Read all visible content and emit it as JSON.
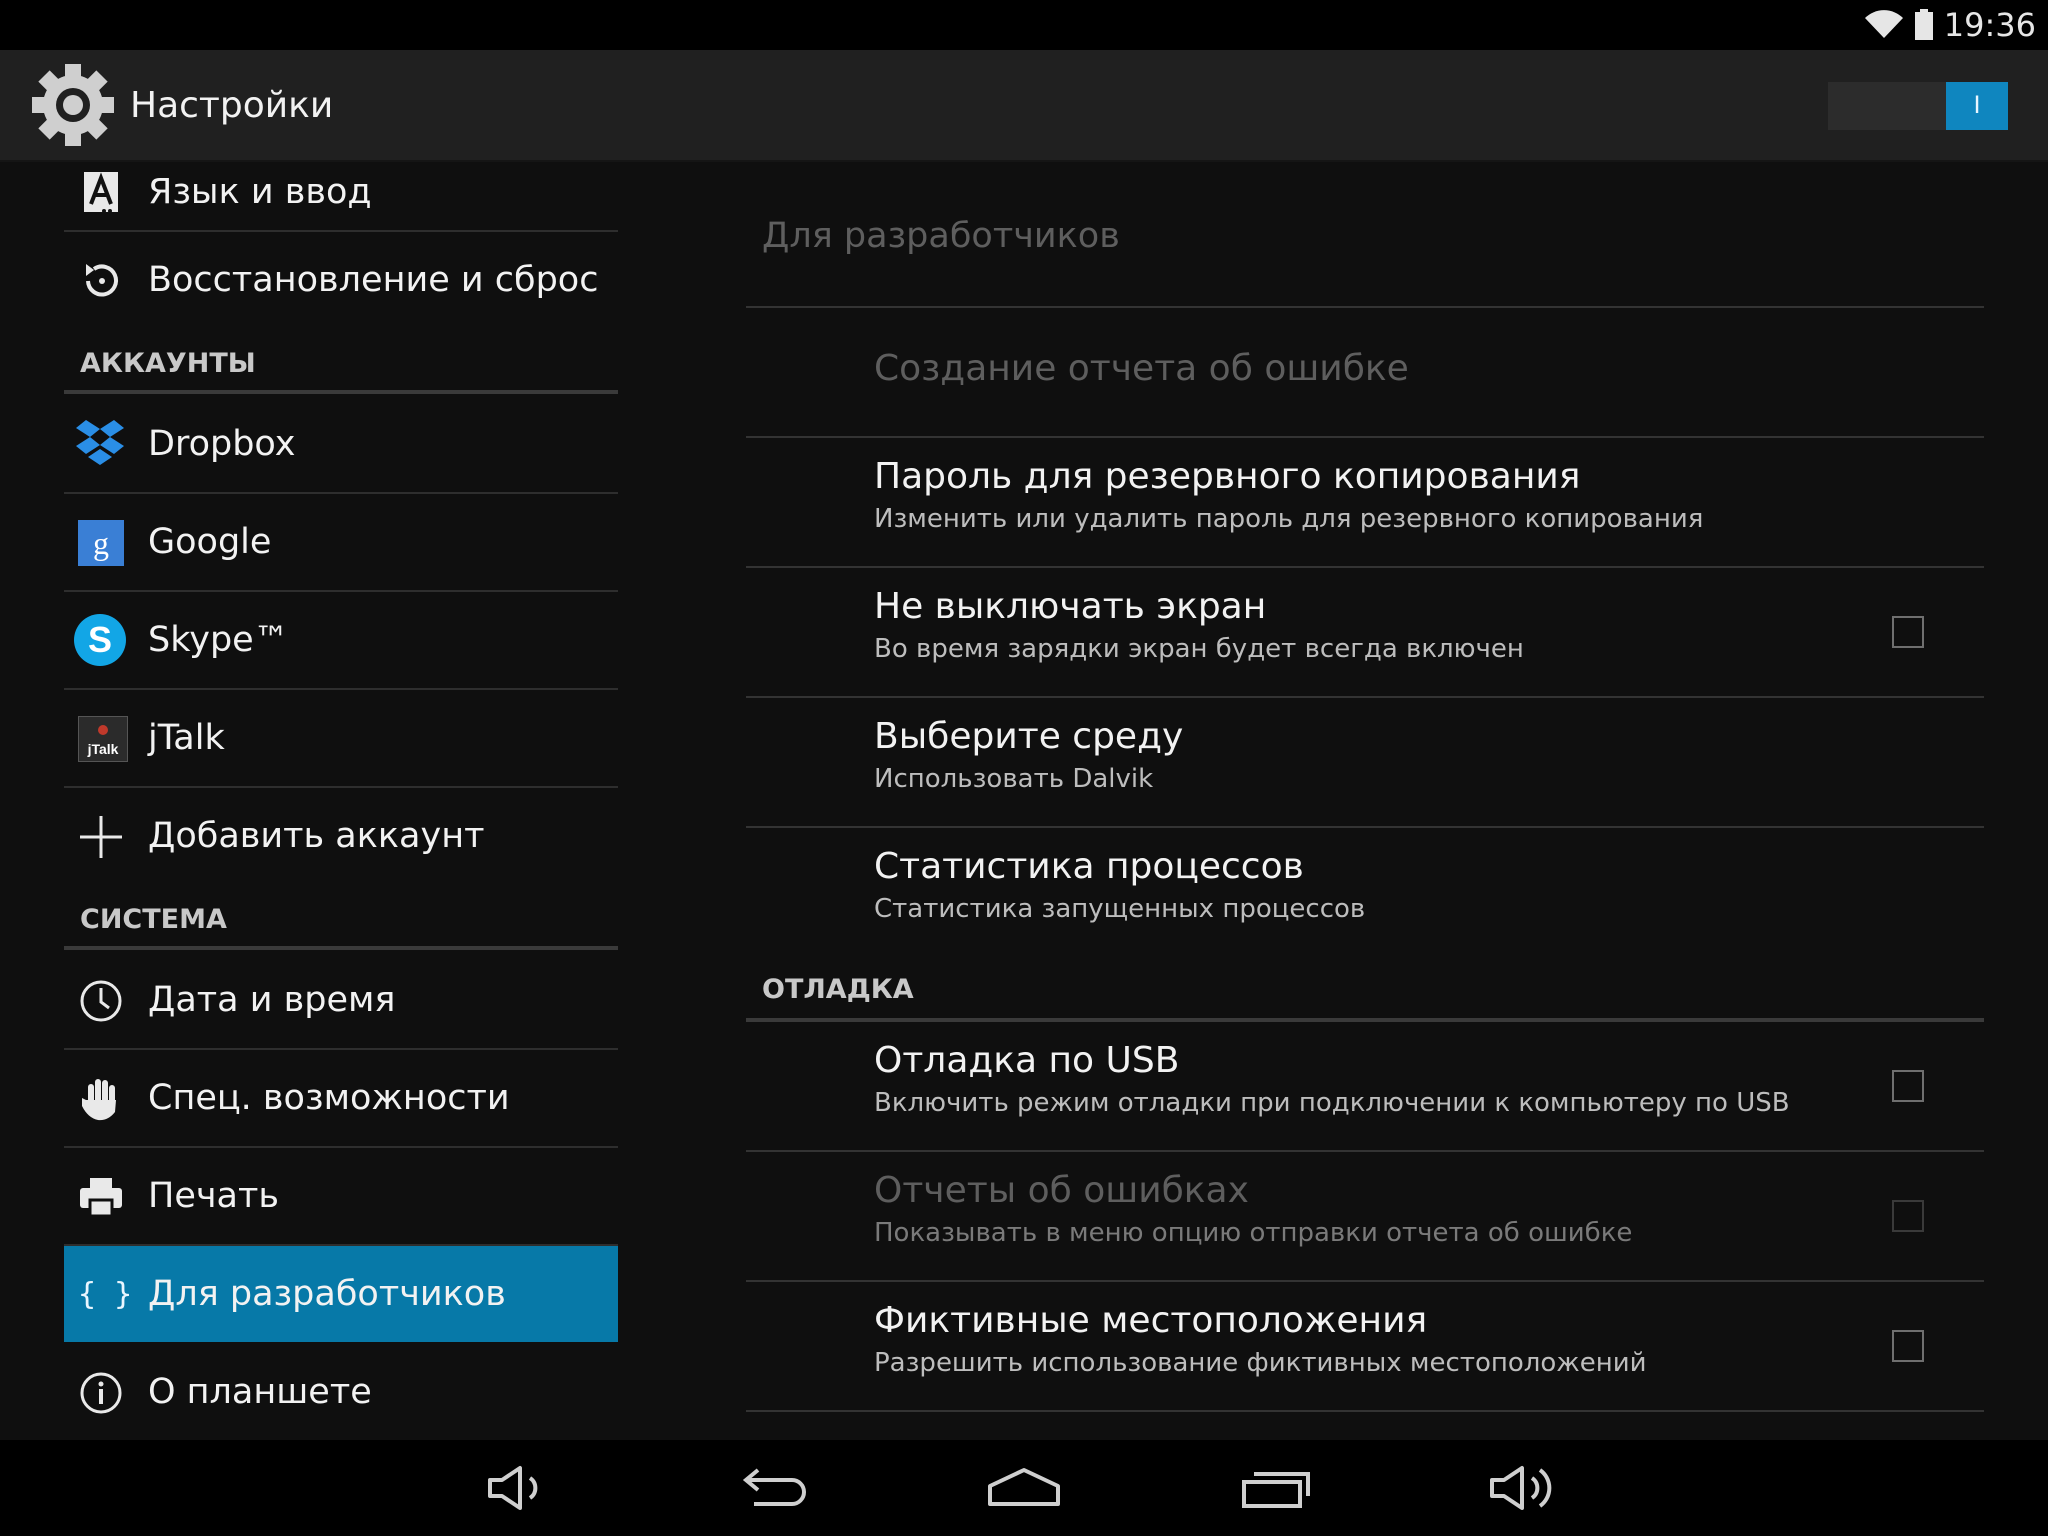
{
  "status_bar": {
    "time": "19:36",
    "wifi_icon": "wifi-icon",
    "battery_icon": "battery-icon"
  },
  "action_bar": {
    "title": "Настройки",
    "icon": "settings-gear-icon",
    "switch_label": "I",
    "switch_on": true
  },
  "left_list": {
    "items_top": [
      {
        "label": "Язык и ввод",
        "icon": "language-icon"
      },
      {
        "label": "Восстановление и сброс",
        "icon": "restore-icon"
      }
    ],
    "accounts_header": "АККАУНТЫ",
    "accounts": [
      {
        "label": "Dropbox",
        "icon": "dropbox-icon"
      },
      {
        "label": "Google",
        "icon": "google-icon"
      },
      {
        "label": "Skype™",
        "icon": "skype-icon"
      },
      {
        "label": "jTalk",
        "icon": "jtalk-icon",
        "icon_text": "jTalk"
      },
      {
        "label": "Добавить аккаунт",
        "icon": "plus-icon"
      }
    ],
    "system_header": "СИСТЕМА",
    "system": [
      {
        "label": "Дата и время",
        "icon": "clock-icon"
      },
      {
        "label": "Спец. возможности",
        "icon": "hand-icon"
      },
      {
        "label": "Печать",
        "icon": "printer-icon"
      },
      {
        "label": "Для разработчиков",
        "icon": "braces-icon",
        "icon_text": "{ }",
        "selected": true
      },
      {
        "label": "О планшете",
        "icon": "info-icon"
      }
    ]
  },
  "right_pane": {
    "title": "Для разработчиков",
    "rows": [
      {
        "title": "Создание отчета об ошибке",
        "summary": "",
        "checkbox": false,
        "enabled": false
      },
      {
        "title": "Пароль для резервного копирования",
        "summary": "Изменить или удалить пароль для резервного копирования",
        "checkbox": false,
        "enabled": true
      },
      {
        "title": "Не выключать экран",
        "summary": "Во время зарядки экран будет всегда включен",
        "checkbox": true,
        "checked": false,
        "enabled": true
      },
      {
        "title": "Выберите среду",
        "summary": "Использовать Dalvik",
        "checkbox": false,
        "enabled": true
      },
      {
        "title": "Статистика процессов",
        "summary": "Статистика запущенных процессов",
        "checkbox": false,
        "enabled": true
      }
    ],
    "debug_header": "ОТЛАДКА",
    "debug_rows": [
      {
        "title": "Отладка по USB",
        "summary": "Включить режим отладки при подключении к компьютеру по USB",
        "checkbox": true,
        "checked": false,
        "enabled": true
      },
      {
        "title": "Отчеты об ошибках",
        "summary": "Показывать в меню опцию отправки отчета об ошибке",
        "checkbox": true,
        "checked": false,
        "enabled": false
      },
      {
        "title": "Фиктивные местоположения",
        "summary": "Разрешить использование фиктивных местоположений",
        "checkbox": true,
        "checked": false,
        "enabled": true
      }
    ]
  },
  "nav_bar": {
    "buttons": [
      "volume-down-icon",
      "back-icon",
      "home-icon",
      "recents-icon",
      "volume-up-icon"
    ]
  },
  "colors": {
    "accent": "#0779a8",
    "switch_on": "#0f86bf",
    "background": "#0f0f0f",
    "action_bar": "#202020"
  }
}
